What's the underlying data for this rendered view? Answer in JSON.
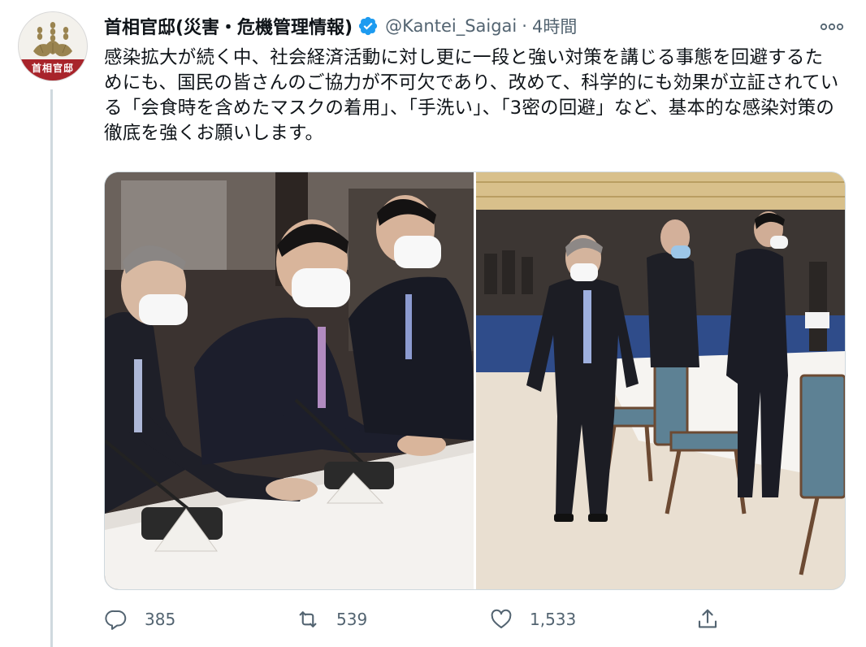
{
  "account": {
    "display_name": "首相官邸(災害・危機管理情報)",
    "handle": "@Kantei_Saigai",
    "separator": "·",
    "time": "4時間",
    "avatar_caption": "首相官邸",
    "verified": true
  },
  "tweet": {
    "text": "感染拡大が続く中、社会経済活動に対し更に一段と強い対策を講じる事態を回避するためにも、国民の皆さんのご協力が不可欠であり、改めて、科学的にも効果が立証されている「会食時を含めたマスクの着用」、「手洗い」、「3密の回避」など、基本的な感染対策の徹底を強くお願いします。"
  },
  "media": {
    "count": 2
  },
  "actions": {
    "reply_count": "385",
    "retweet_count": "539",
    "like_count": "1,533"
  },
  "icons": {
    "verified": "verified-badge-icon",
    "more": "more-options-icon",
    "reply": "reply-icon",
    "retweet": "retweet-icon",
    "like": "heart-icon",
    "share": "share-icon"
  },
  "colors": {
    "text": "#0f1419",
    "secondary": "#536471",
    "verified_blue": "#1d9bf0",
    "avatar_red": "#a8242b",
    "border": "#cfd9de"
  }
}
